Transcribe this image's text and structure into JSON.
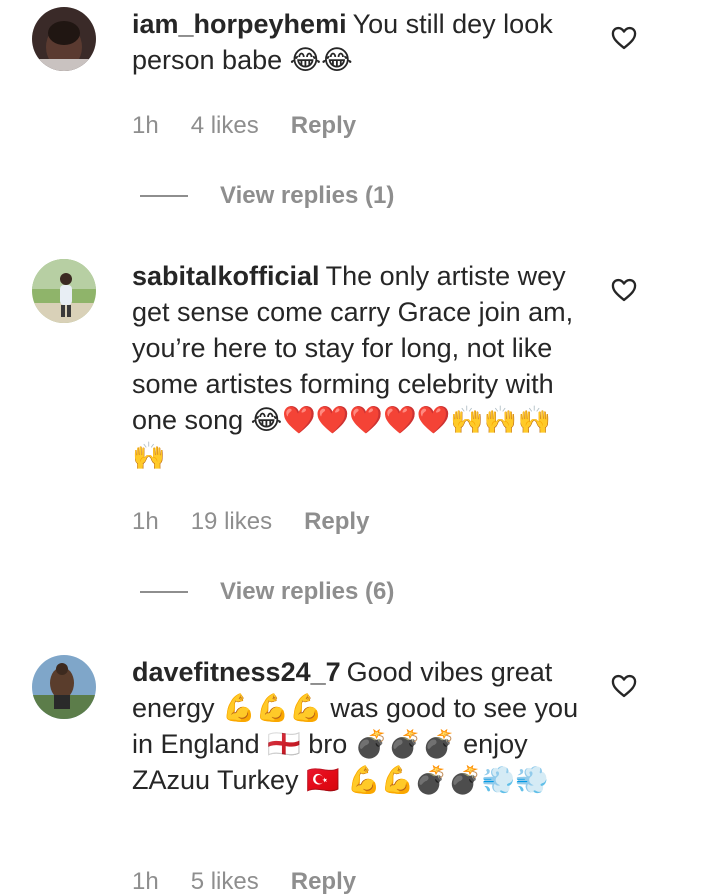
{
  "comments": [
    {
      "username": "iam_horpeyhemi",
      "text": "You still dey look person babe 😂😂",
      "time": "1h",
      "likes": "4 likes",
      "reply": "Reply",
      "view_replies": "View replies (1)"
    },
    {
      "username": "sabitalkofficial",
      "text": "The only artiste wey get sense come carry Grace join am, you’re here to stay for long, not like some artistes forming celebrity with one song 😂❤️❤️❤️❤️❤️🙌🙌🙌🙌",
      "time": "1h",
      "likes": "19 likes",
      "reply": "Reply",
      "view_replies": "View replies (6)"
    },
    {
      "username": "davefitness24_7",
      "text": "Good vibes great energy 💪💪💪 was good to see you in England 🏴󠁧󠁢󠁥󠁮󠁧󠁿 bro 💣💣💣 enjoy ZAzuu Turkey 🇹🇷 💪💪💣💣💨💨",
      "time": "1h",
      "likes": "5 likes",
      "reply": "Reply"
    }
  ],
  "colors": {
    "text": "#262626",
    "meta": "#8e8e8e"
  },
  "icons": {
    "like": "heart-outline-icon"
  }
}
